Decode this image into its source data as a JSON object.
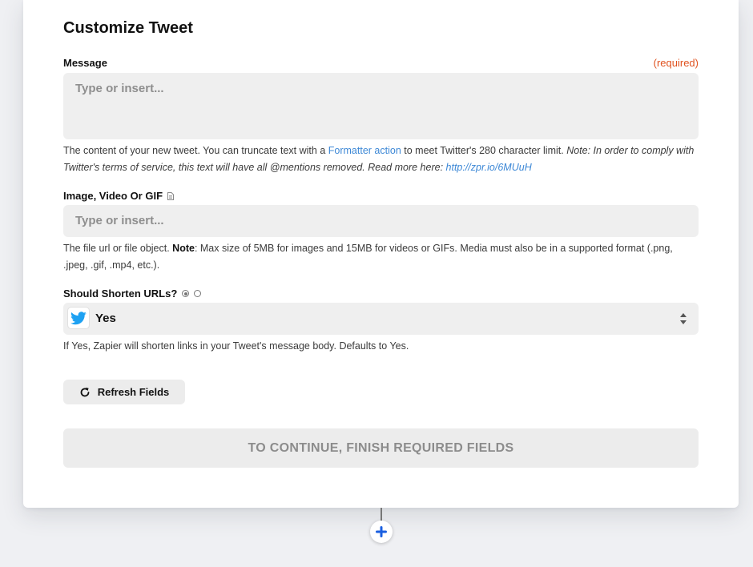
{
  "section": {
    "title": "Customize Tweet"
  },
  "message": {
    "label": "Message",
    "required": "(required)",
    "placeholder": "Type or insert...",
    "help_text_1": "The content of your new tweet. You can truncate text with a ",
    "help_link": "Formatter action",
    "help_text_2": " to meet Twitter's 280 character limit. ",
    "help_note": "Note: In order to comply with Twitter's terms of service, this text will have all @mentions removed. Read more here: ",
    "help_note_link": "http://zpr.io/6MUuH"
  },
  "media": {
    "label": "Image, Video Or GIF",
    "icon": "file-icon",
    "placeholder": "Type or insert...",
    "help_text_1": "The file url or file object. ",
    "help_bold": "Note",
    "help_text_2": ": Max size of 5MB for images and 15MB for videos or GIFs. Media must also be in a supported format (.png, .jpeg, .gif, .mp4, etc.)."
  },
  "shorten": {
    "label": "Should Shorten URLs?",
    "radio_selected": "first",
    "value": "Yes",
    "value_icon": "twitter-bird-icon",
    "help": "If Yes, Zapier will shorten links in your Tweet's message body. Defaults to Yes."
  },
  "buttons": {
    "refresh": "Refresh Fields",
    "continue": "TO CONTINUE, FINISH REQUIRED FIELDS"
  },
  "colors": {
    "required": "#e0521f",
    "link": "#3d88d6",
    "twitter": "#1da1f2",
    "add_step": "#1a5fe0"
  }
}
